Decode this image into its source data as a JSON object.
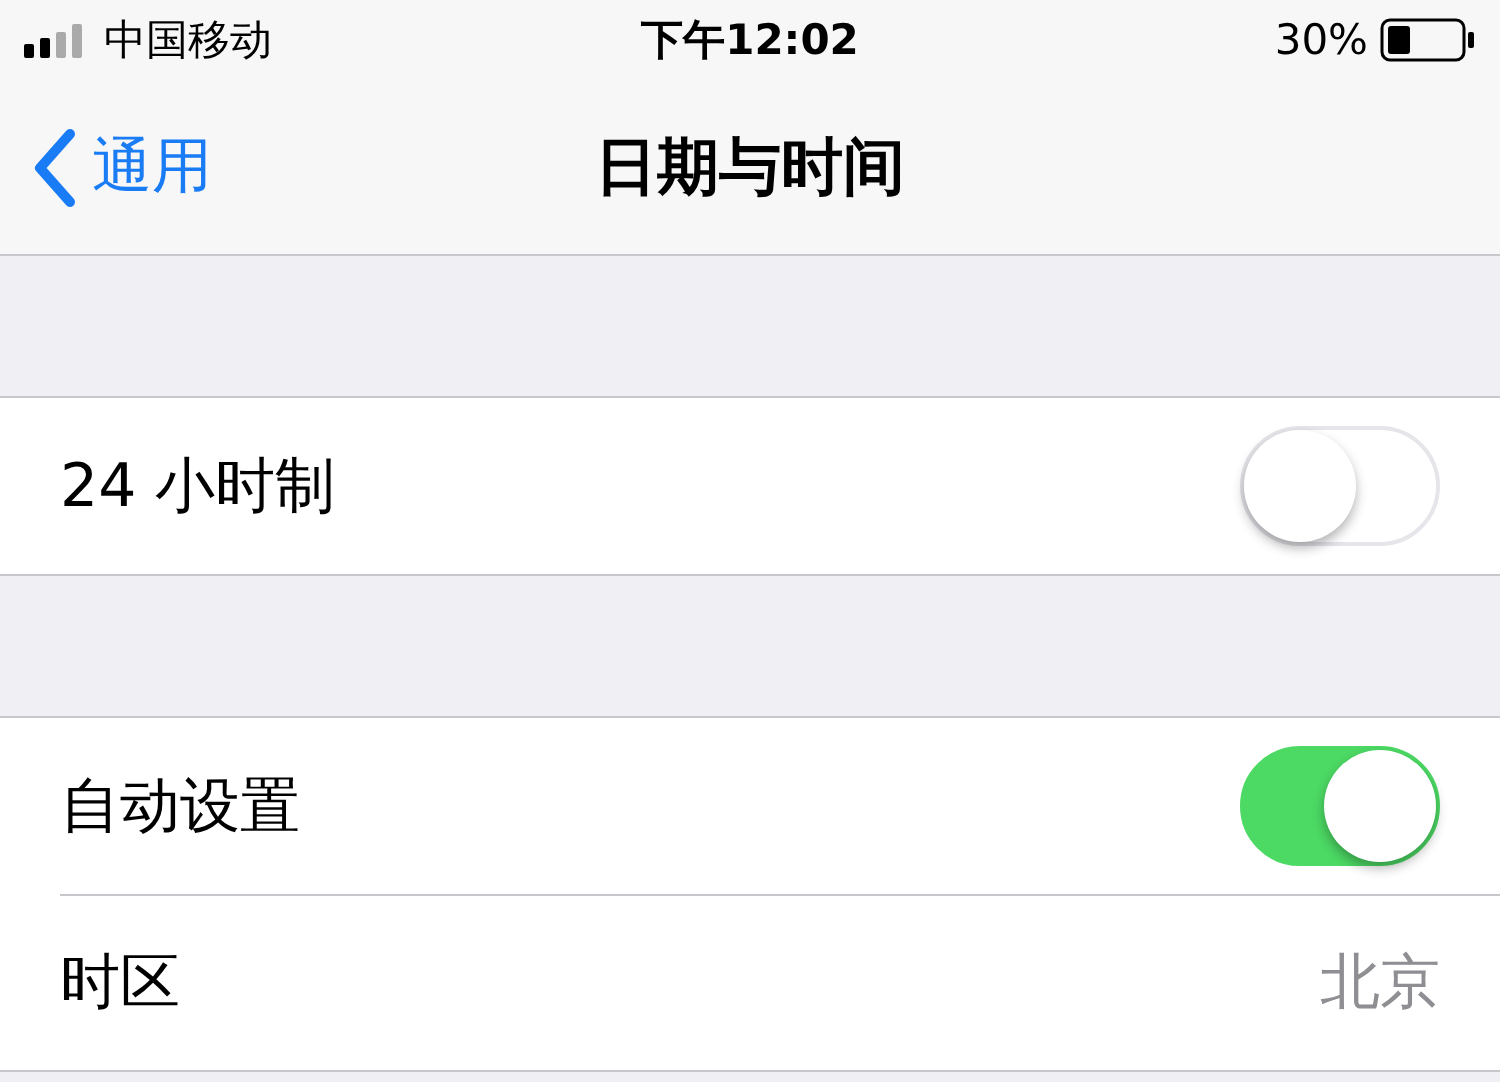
{
  "status_bar": {
    "carrier": "中国移动",
    "time": "下午12:02",
    "battery": "30%"
  },
  "nav": {
    "back": "通用",
    "title": "日期与时间"
  },
  "sections": [
    {
      "rows": [
        {
          "kind": "switch",
          "label": "24 小时制",
          "on": false
        }
      ]
    },
    {
      "rows": [
        {
          "kind": "switch",
          "label": "自动设置",
          "on": true
        },
        {
          "kind": "value",
          "label": "时区",
          "value": "北京"
        }
      ]
    }
  ]
}
